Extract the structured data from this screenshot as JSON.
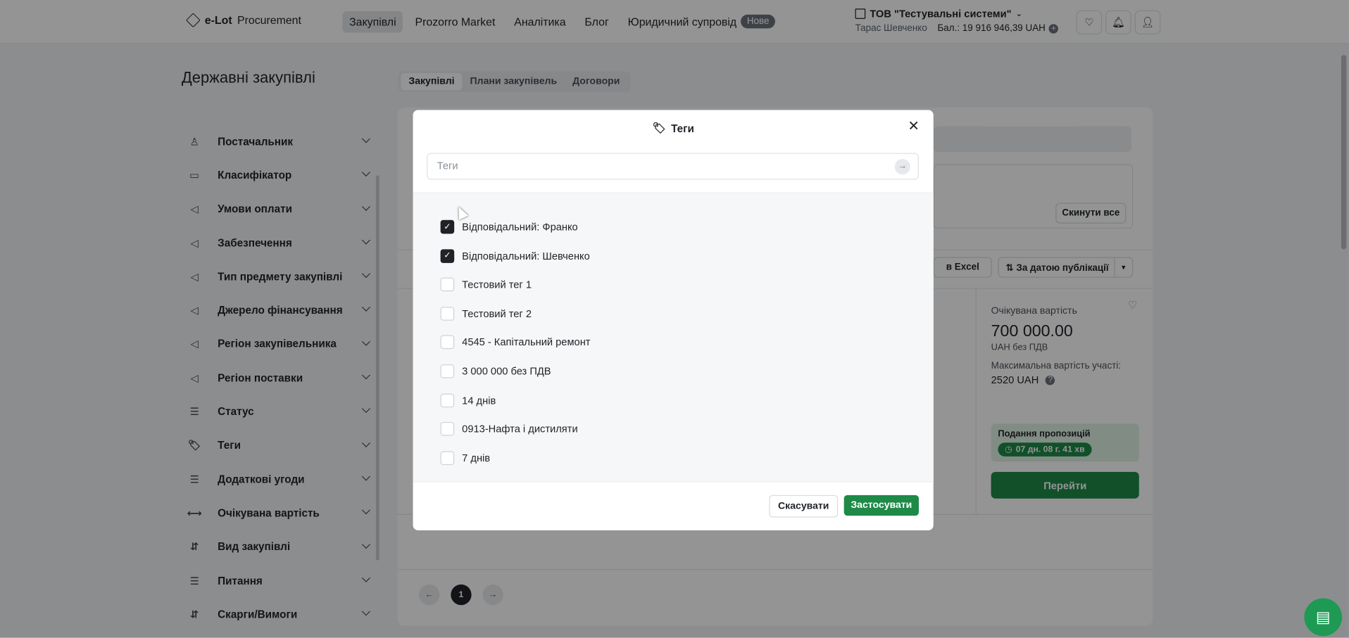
{
  "header": {
    "logo_bold": "e-Lot",
    "logo_text": "Procurement",
    "nav": [
      {
        "label": "Закупівлі",
        "active": true
      },
      {
        "label": "Prozorro Market"
      },
      {
        "label": "Аналітика"
      },
      {
        "label": "Блог"
      },
      {
        "label": "Юридичний супровід",
        "badge": "Нове"
      }
    ],
    "company": "ТОВ \"Тестувальні системи\"",
    "user": "Тарас Шевченко",
    "balance": "Бал.: 19 916 946,39 UAH",
    "icons": [
      "heart-icon",
      "bell-icon",
      "user-icon"
    ]
  },
  "page": {
    "title": "Державні закупівлі",
    "tabs": [
      "Закупівлі",
      "Плани закупівель",
      "Договори"
    ]
  },
  "sidebar": {
    "items": [
      {
        "label": "Постачальник",
        "icon": "person-icon"
      },
      {
        "label": "Класифікатор",
        "icon": "book-icon"
      },
      {
        "label": "Умови оплати",
        "icon": "tag-icon"
      },
      {
        "label": "Забезпечення",
        "icon": "tag-icon"
      },
      {
        "label": "Тип предмету закупівлі",
        "icon": "tag-icon"
      },
      {
        "label": "Джерело фінансування",
        "icon": "tag-icon"
      },
      {
        "label": "Регіон закупівельника",
        "icon": "tag-icon"
      },
      {
        "label": "Регіон поставки",
        "icon": "tag-icon"
      },
      {
        "label": "Статус",
        "icon": "list-icon"
      },
      {
        "label": "Теги",
        "icon": "tags-icon"
      },
      {
        "label": "Додаткові угоди",
        "icon": "list-icon"
      },
      {
        "label": "Очікувана вартість",
        "icon": "range-icon"
      },
      {
        "label": "Вид закупівлі",
        "icon": "sort-icon"
      },
      {
        "label": "Питання",
        "icon": "list-icon"
      },
      {
        "label": "Скарги/Вимоги",
        "icon": "sort-icon"
      }
    ]
  },
  "results": {
    "reset": "Скинути все",
    "excel": "в Excel",
    "sort": "За датою публікації",
    "card": {
      "expected_label": "Очікувана вартість",
      "expected_value": "700 000.00",
      "vat": "UAH без ПДВ",
      "max_label": "Максимальна вартість участі:",
      "max_value": "2520 UAH",
      "offers_title": "Подання пропозицій",
      "offers_timer": "07 дн. 08 г. 41 хв",
      "go": "Перейти"
    },
    "pager": {
      "current": "1"
    }
  },
  "modal": {
    "title": "Теги",
    "search_placeholder": "Теги",
    "tags": [
      {
        "label": "Відповідальний: Франко",
        "checked": true
      },
      {
        "label": "Відповідальний: Шевченко",
        "checked": true
      },
      {
        "label": "Тестовий тег 1",
        "checked": false
      },
      {
        "label": "Тестовий тег 2",
        "checked": false
      },
      {
        "label": "4545 - Капітальний ремонт",
        "checked": false
      },
      {
        "label": "3 000 000 без ПДВ",
        "checked": false
      },
      {
        "label": "14 днів",
        "checked": false
      },
      {
        "label": "0913-Нафта і дистиляти",
        "checked": false
      },
      {
        "label": "7 днів",
        "checked": false
      }
    ],
    "cancel": "Скасувати",
    "apply": "Застосувати"
  },
  "colors": {
    "accent": "#1e8a48",
    "dark": "#1f2328"
  }
}
